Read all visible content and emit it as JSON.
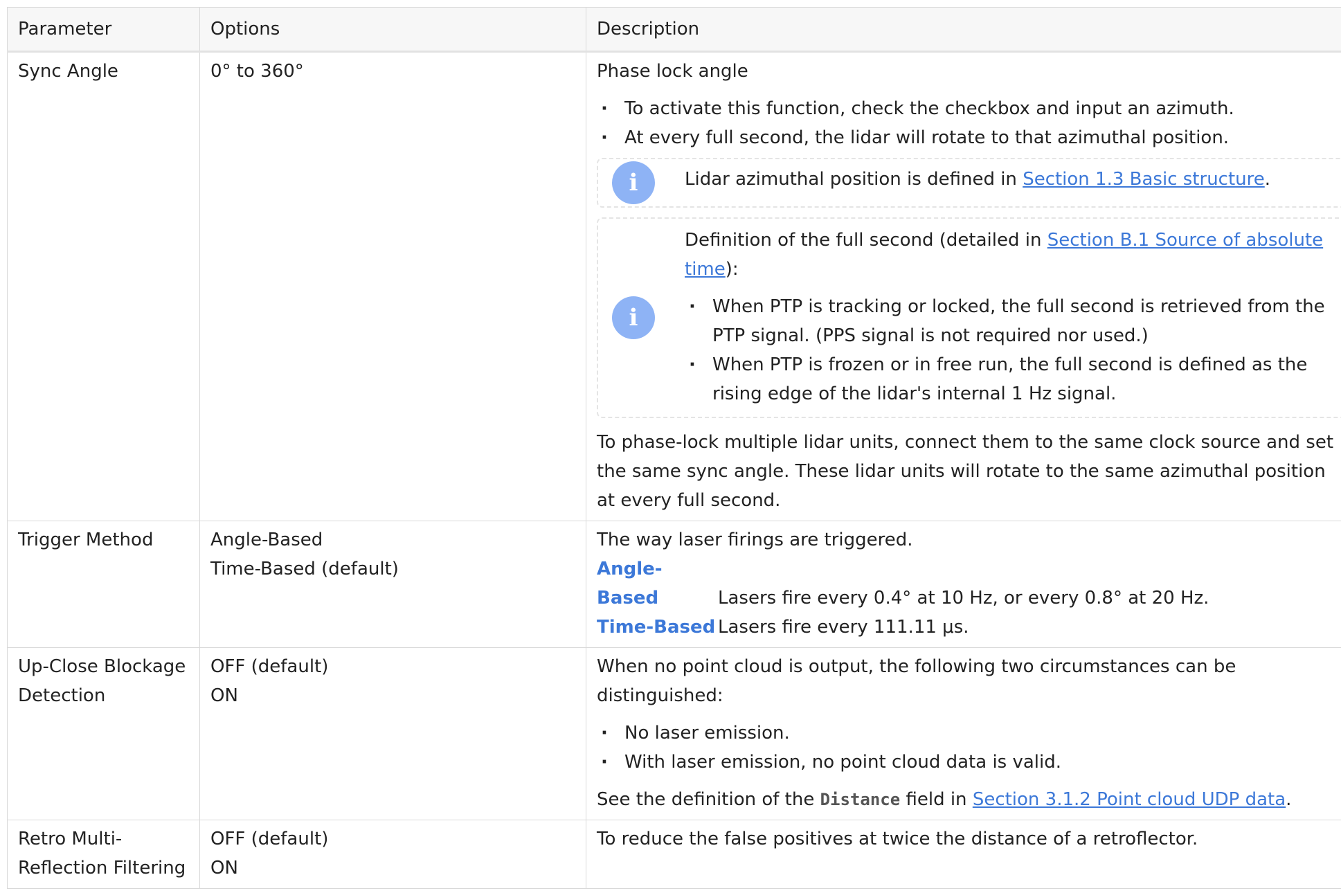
{
  "headers": {
    "parameter": "Parameter",
    "options": "Options",
    "description": "Description"
  },
  "rows": [
    {
      "parameter": "Sync Angle",
      "options": [
        "0° to 360°"
      ],
      "lead": "Phase lock angle",
      "bullets": [
        "To activate this function, check the checkbox and input an azimuth.",
        "At every full second, the lidar will rotate to that azimuthal position."
      ],
      "note1": {
        "prefix": "Lidar azimuthal position is defined in ",
        "link": "Section 1.3 Basic structure",
        "suffix": "."
      },
      "note2": {
        "prefix": "Definition of the full second (detailed in ",
        "link": "Section B.1 Source of absolute time",
        "suffix": "):",
        "bullets": [
          "When PTP is tracking or locked, the full second is retrieved from the PTP signal. (PPS signal is not required nor used.)",
          "When PTP is frozen or in free run, the full second is defined as the rising edge of the lidar's internal 1 Hz signal."
        ]
      },
      "closing": "To phase-lock multiple lidar units, connect them to the same clock source and set the same sync angle. These lidar units will rotate to the same azimuthal position at every full second."
    },
    {
      "parameter": "Trigger Method",
      "options": [
        "Angle-Based",
        "Time-Based (default)"
      ],
      "lead": "The way laser firings are triggered.",
      "definitions": [
        {
          "term": "Angle-Based",
          "text": "Lasers fire every 0.4° at 10 Hz, or every 0.8° at 20 Hz."
        },
        {
          "term": "Time-Based",
          "text": "Lasers fire every 111.11 μs."
        }
      ]
    },
    {
      "parameter": "Up-Close Blockage Detection",
      "options": [
        "OFF (default)",
        "ON"
      ],
      "lead": "When no point cloud is output, the following two circumstances can be distinguished:",
      "bullets": [
        "No laser emission.",
        "With laser emission, no point cloud data is valid."
      ],
      "see": {
        "prefix": "See the definition of the ",
        "code": "Distance",
        "middle": " field in ",
        "link": "Section 3.1.2 Point cloud UDP data",
        "suffix": "."
      }
    },
    {
      "parameter": "Retro Multi-Reflection Filtering",
      "options": [
        "OFF (default)",
        "ON"
      ],
      "lead": "To reduce the false positives at twice the distance of a retroflector."
    }
  ],
  "icons": {
    "info": "info-icon",
    "info_glyph": "i"
  },
  "colors": {
    "link": "#3c78d8",
    "info_icon_bg": "#8eb3f5",
    "header_bg": "#f7f7f7"
  }
}
